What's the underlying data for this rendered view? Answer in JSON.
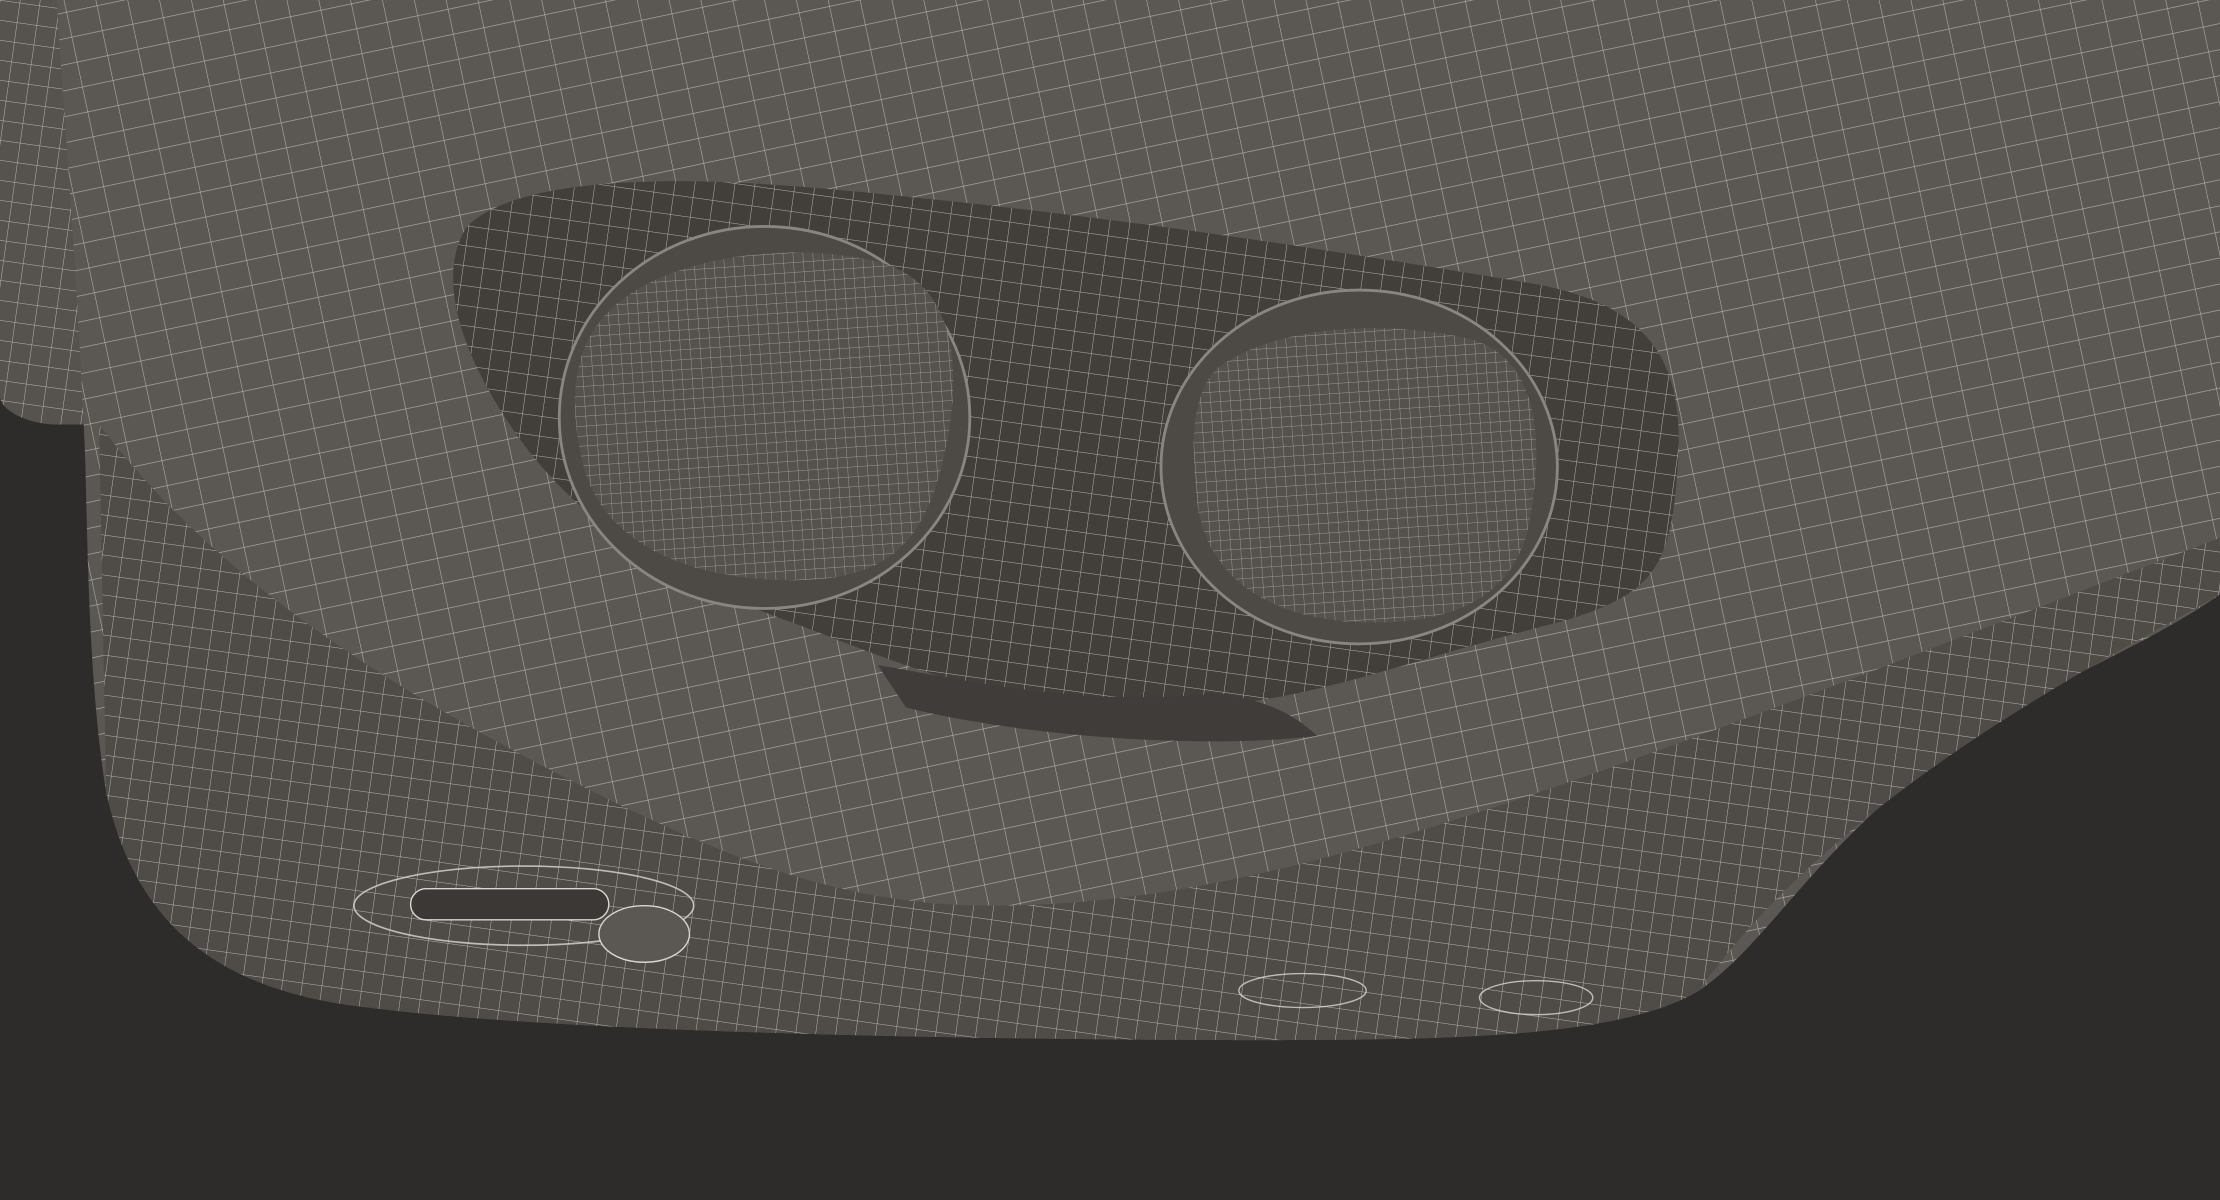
{
  "scene": {
    "subject": "vr-headset-wireframe",
    "colors": {
      "background": "#2d2c2a",
      "surface": "#5b5752",
      "surface_dark": "#4a4743",
      "cavity": "#403d3a",
      "wire": "#d9d6d0"
    }
  }
}
